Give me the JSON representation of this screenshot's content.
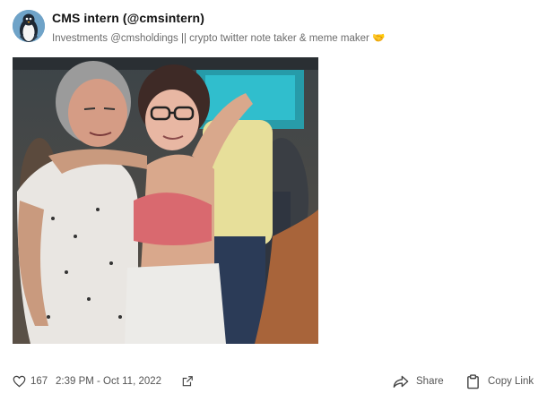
{
  "tweet": {
    "display_name": "CMS intern (@cmsintern)",
    "bio": "Investments @cmsholdings || crypto twitter note taker & meme maker 🤝",
    "avatar_icon": "penguin-avatar-icon",
    "image_alt": "Photo"
  },
  "footer": {
    "like_icon": "heart-icon",
    "like_count": "167",
    "timestamp": "2:39 PM - Oct 11, 2022",
    "external_icon": "external-link-icon",
    "share_icon": "share-arrow-icon",
    "share_label": "Share",
    "copy_icon": "clipboard-icon",
    "copy_label": "Copy Link"
  },
  "colors": {
    "text_primary": "#111111",
    "text_secondary": "#6b6b6b",
    "background": "#ffffff"
  }
}
